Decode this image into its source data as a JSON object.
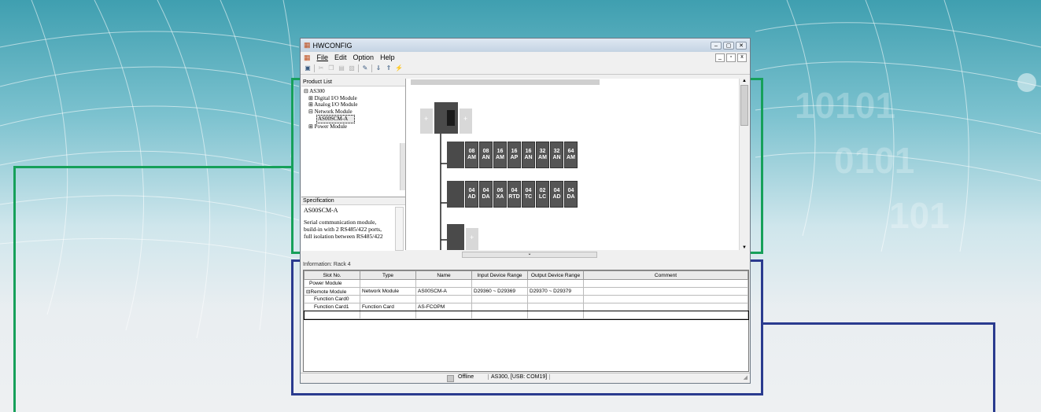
{
  "window": {
    "title": "HWCONFIG"
  },
  "menu": {
    "file": "File",
    "edit": "Edit",
    "option": "Option",
    "help": "Help"
  },
  "product_list": {
    "header": "Product List",
    "root": "AS300",
    "items": [
      "Digital I/O Module",
      "Analog I/O Module",
      "Network Module",
      "Power Module"
    ],
    "selected": "AS00SCM-A"
  },
  "specification": {
    "header": "Specification",
    "name": "AS00SCM-A",
    "description": "Serial communication module, build-in with 2 RS485/422 ports, full isolation between RS485/422"
  },
  "rack": {
    "row1_labels": [
      "08 AM",
      "08 AN",
      "16 AM",
      "16 AP",
      "16 AN",
      "32 AM",
      "32 AN",
      "64 AM"
    ],
    "row2_labels": [
      "04 AD",
      "04 DA",
      "06 XA",
      "04 RTD",
      "04 TC",
      "02 LC",
      "04 AD",
      "04 DA"
    ],
    "plus": "+"
  },
  "information": {
    "header": "Information: Rack 4",
    "columns": [
      "Slot No.",
      "Type",
      "Name",
      "Input Device Range",
      "Output Device Range",
      "Comment"
    ],
    "rows": [
      [
        "Power Module",
        "",
        "",
        "",
        "",
        ""
      ],
      [
        "Remote Module",
        "Network Module",
        "AS00SCM-A",
        "D29360 ~ D29369",
        "D29370 ~ D29379",
        ""
      ],
      [
        "Function Card0",
        "",
        "",
        "",
        "",
        ""
      ],
      [
        "Function Card1",
        "Function Card",
        "AS-FCOPM",
        "",
        "",
        ""
      ],
      [
        "",
        "",
        "",
        "",
        "",
        ""
      ]
    ]
  },
  "status": {
    "mode": "Offline",
    "connection": "AS300, [USB: COM19]"
  },
  "colors": {
    "green_highlight": "#16a05a",
    "blue_highlight": "#2a3b8f",
    "module_dark": "#454545"
  }
}
